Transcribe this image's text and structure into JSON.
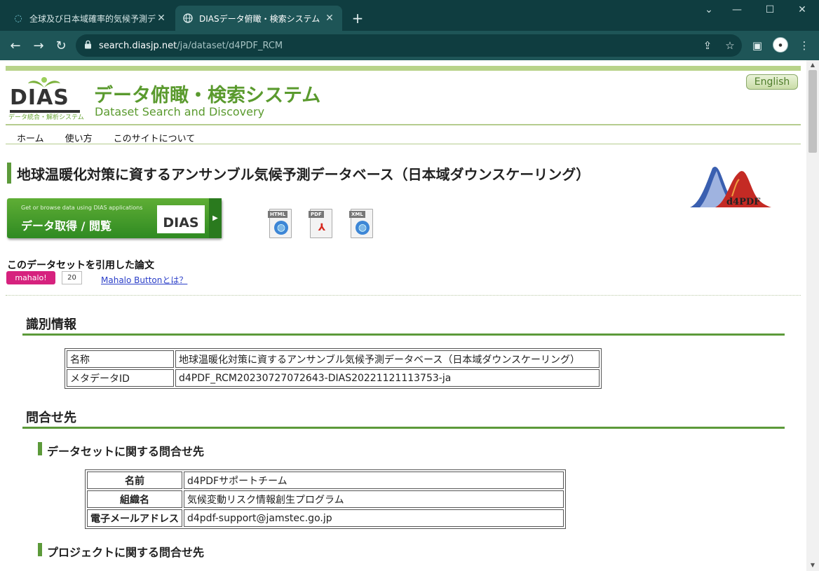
{
  "browser": {
    "tabs": [
      {
        "title": "全球及び日本域確率的気候予測デ",
        "active": false
      },
      {
        "title": "DIASデータ俯瞰・検索システム",
        "active": true
      }
    ],
    "url_host": "search.diasjp.net",
    "url_path": "/ja/dataset/d4PDF_RCM",
    "icons": {
      "tab1_favicon": "spinner-globe-icon",
      "tab2_favicon": "globe-icon",
      "close": "✕",
      "newtab": "+",
      "back": "←",
      "forward": "→",
      "reload": "↻",
      "lock": "🔒",
      "share": "⇪",
      "star": "☆",
      "sidepanel": "▣",
      "menu": "⋮",
      "minimize": "⌄",
      "min2": "—",
      "max": "☐",
      "winclose": "✕"
    }
  },
  "header": {
    "logo_text": "DIAS",
    "logo_sub": "データ統合・解析システム",
    "title": "データ俯瞰・検索システム",
    "subtitle": "Dataset Search and Discovery",
    "english_btn": "English"
  },
  "nav": {
    "items": [
      "ホーム",
      "使い方",
      "このサイトについて"
    ]
  },
  "dataset": {
    "title": "地球温暖化対策に資するアンサンブル気候予測データベース（日本域ダウンスケーリング）",
    "logo_text": "d4PDF",
    "get_small": "Get or browse data using DIAS applications",
    "get_big": "データ取得 / 閲覧",
    "get_logo": "DIAS",
    "doc_icons": [
      "HTML",
      "PDF",
      "XML"
    ]
  },
  "citation": {
    "label": "このデータセットを引用した論文",
    "mahalo_label": "mahalo!",
    "mahalo_count": "20",
    "mahalo_link": "Mahalo Buttonとは？"
  },
  "identification": {
    "heading": "識別情報",
    "rows": [
      {
        "label": "名称",
        "value": "地球温暖化対策に資するアンサンブル気候予測データベース（日本域ダウンスケーリング）"
      },
      {
        "label": "メタデータID",
        "value": "d4PDF_RCM20230727072643-DIAS20221121113753-ja"
      }
    ]
  },
  "contact": {
    "heading": "問合せ先",
    "dataset_heading": "データセットに関する問合せ先",
    "rows": [
      {
        "label": "名前",
        "value": "d4PDFサポートチーム"
      },
      {
        "label": "組織名",
        "value": "気候変動リスク情報創生プログラム"
      },
      {
        "label": "電子メールアドレス",
        "value": "d4pdf-support@jamstec.go.jp"
      }
    ],
    "project_heading": "プロジェクトに関する問合せ先"
  },
  "colors": {
    "brand_green": "#5a9a2e",
    "mahalo_pink": "#d6227e",
    "chrome_dark": "#0f3d40",
    "chrome_toolbar": "#1e5557"
  }
}
